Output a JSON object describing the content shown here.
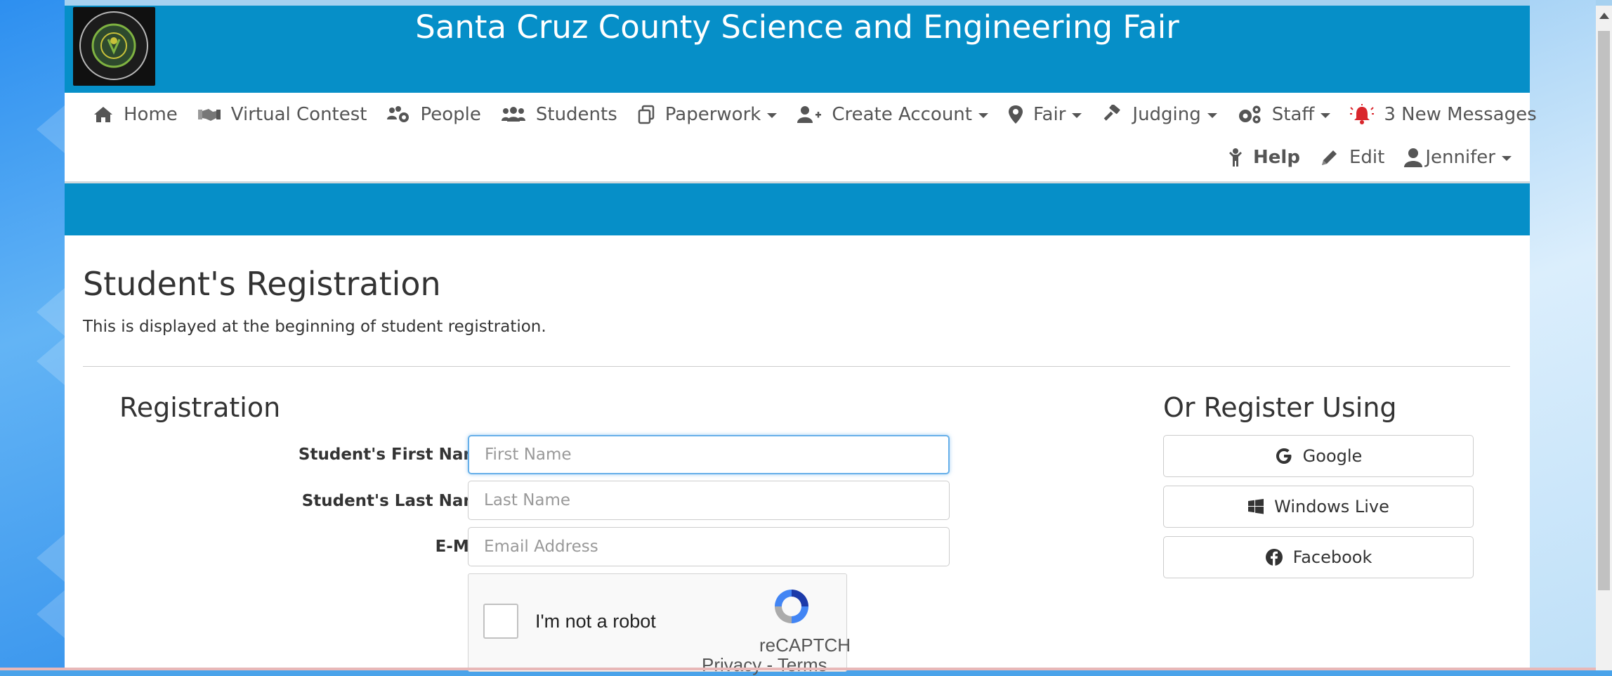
{
  "header": {
    "title": "Santa Cruz County Science and Engineering Fair",
    "logo_text": "santa cruz county science & engineering fair"
  },
  "nav": {
    "items": [
      {
        "label": "Home",
        "icon": "home-icon"
      },
      {
        "label": "Virtual Contest",
        "icon": "handshake-icon"
      },
      {
        "label": "People",
        "icon": "people-cog-icon"
      },
      {
        "label": "Students",
        "icon": "users-icon"
      },
      {
        "label": "Paperwork",
        "icon": "copy-icon"
      },
      {
        "label": "Create Account",
        "icon": "user-plus-icon"
      },
      {
        "label": "Fair",
        "icon": "map-marker-icon"
      },
      {
        "label": "Judging",
        "icon": "gavel-icon"
      },
      {
        "label": "Staff",
        "icon": "cogs-icon"
      },
      {
        "label": "3 New Messages",
        "icon": "alarm-bell-icon"
      }
    ],
    "secondary": [
      {
        "label": "Help",
        "icon": "child-icon"
      },
      {
        "label": "Edit",
        "icon": "pencil-icon"
      },
      {
        "label": "Jennifer",
        "icon": "user-icon"
      }
    ]
  },
  "page": {
    "title": "Student's Registration",
    "description": "This is displayed at the beginning of student registration."
  },
  "registration": {
    "title": "Registration",
    "fields": [
      {
        "label": "Student's First Name",
        "placeholder": "First Name",
        "value": ""
      },
      {
        "label": "Student's Last Name",
        "placeholder": "Last Name",
        "value": ""
      },
      {
        "label": "E-Mail",
        "placeholder": "Email Address",
        "value": ""
      }
    ],
    "captcha": {
      "label": "I'm not a robot",
      "brand": "reCAPTCH",
      "privacy": "Privacy",
      "separator": " - ",
      "terms": "Terms"
    }
  },
  "social": {
    "title": "Or Register Using",
    "buttons": [
      {
        "label": "Google",
        "icon": "google-icon"
      },
      {
        "label": "Windows Live",
        "icon": "windows-icon"
      },
      {
        "label": "Facebook",
        "icon": "facebook-icon"
      }
    ]
  },
  "colors": {
    "brand": "#068fc8",
    "focus": "#66afe9",
    "alert": "#d9262c"
  }
}
